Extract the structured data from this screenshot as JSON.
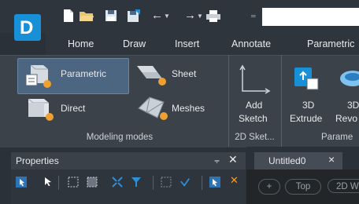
{
  "app": {
    "logo_letter": "D",
    "title_value": ""
  },
  "quick_access": {
    "icons": [
      "new-file-icon",
      "open-folder-icon",
      "save-icon",
      "save-as-icon",
      "undo-icon",
      "redo-icon",
      "print-icon",
      "customize-icon"
    ]
  },
  "menu": {
    "tabs": [
      "Home",
      "Draw",
      "Insert",
      "Annotate",
      "Parametric"
    ]
  },
  "ribbon": {
    "modeling_modes": {
      "buttons": [
        "Parametric",
        "Sheet",
        "Direct",
        "Meshes"
      ],
      "label": "Modeling modes"
    },
    "sketch_2d": {
      "button_line1": "Add",
      "button_line2": "Sketch",
      "label": "2D Sket..."
    },
    "parametric": {
      "buttons": [
        {
          "line1": "3D",
          "line2": "Extrude"
        },
        {
          "line1": "3D",
          "line2": "Revo"
        }
      ],
      "label": "Parame"
    }
  },
  "properties_panel": {
    "title": "Properties",
    "pin_icon": "pin-icon",
    "close_icon": "close-icon"
  },
  "document": {
    "tab_label": "Untitled0",
    "close": "×"
  },
  "viewport": {
    "plus": "+",
    "view": "Top",
    "mode": "2D W"
  },
  "colors": {
    "accent": "#1890d8",
    "selected": "#4c6580",
    "orange": "#f0a030"
  }
}
